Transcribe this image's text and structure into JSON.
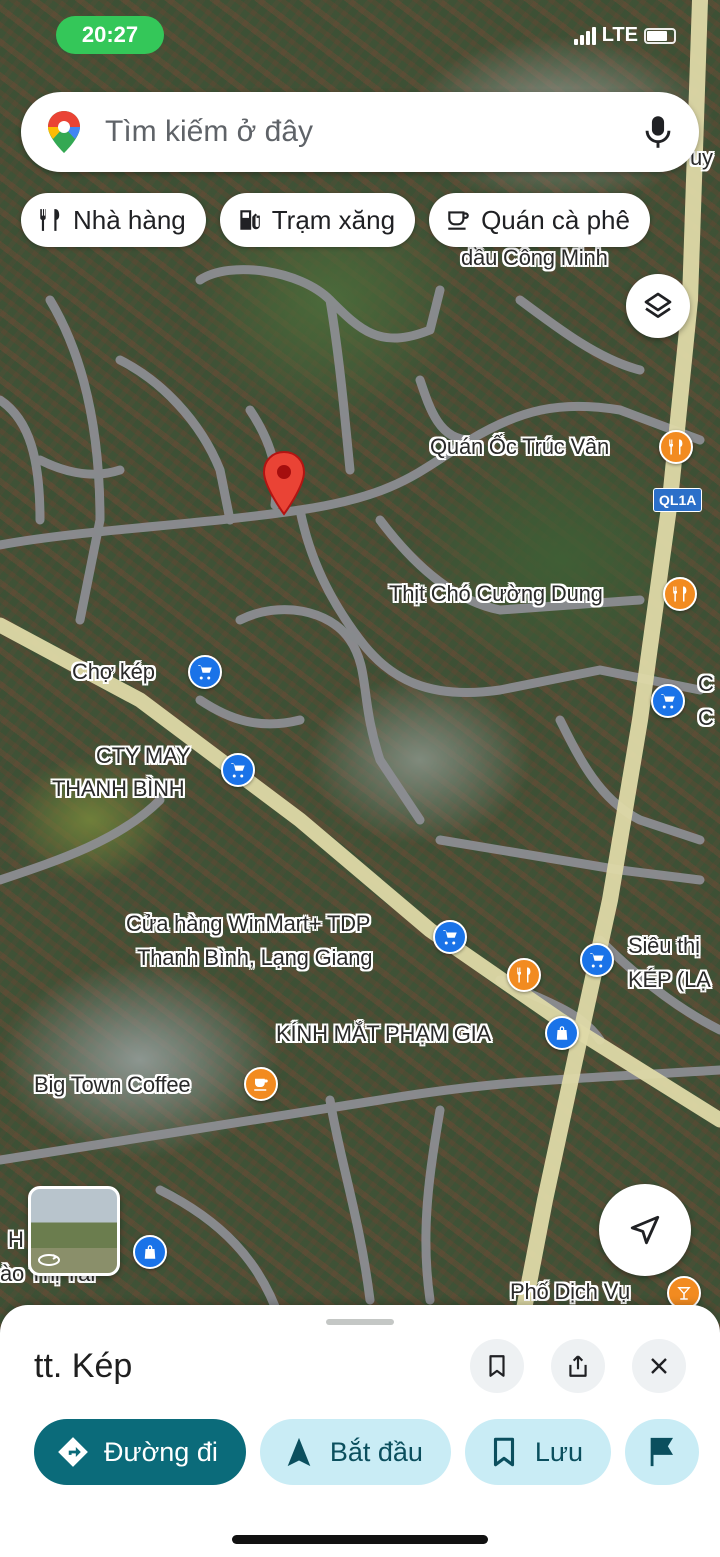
{
  "status_bar": {
    "time": "20:27",
    "network": "LTE"
  },
  "search": {
    "placeholder": "Tìm kiếm ở đây"
  },
  "chips": [
    {
      "label": "Nhà hàng",
      "icon": "restaurant-icon"
    },
    {
      "label": "Trạm xăng",
      "icon": "gas-station-icon"
    },
    {
      "label": "Quán cà phê",
      "icon": "coffee-icon"
    }
  ],
  "map": {
    "road_shield": "QL1A",
    "labels": {
      "cong_minh": "dầu Công Minh",
      "truc_van": "Quán Ốc Trúc Vân",
      "cuong_dung": "Thịt Chó Cường Dung",
      "cho_kep": "Chợ kép",
      "cty_may_1": "CTY MAY",
      "cty_may_2": "THANH BÌNH",
      "winmart_1": "Cửa hàng WinMart+ TDP",
      "winmart_2": "Thanh Bình, Lạng Giang",
      "sieu_thi_1": "Siêu thị",
      "sieu_thi_2": "KÉP (LẠ",
      "kinh_mat": "KÍNH MẮT PHẠM GIA",
      "big_town": "Big Town Coffee",
      "pho_dich_vu": "Phố Dịch Vụ",
      "edge_c1": "C",
      "edge_c2": "C",
      "edge_h": "H",
      "edge_ao": "ào Thị Tài",
      "edge_uy": "uy"
    }
  },
  "sheet": {
    "title": "tt. Kép",
    "actions": {
      "directions": "Đường đi",
      "start": "Bắt đầu",
      "save": "Lưu"
    }
  },
  "colors": {
    "accent": "#0b6b7a",
    "poi_blue": "#1a73e8",
    "poi_orange": "#f28b20",
    "marker_red": "#ea4335"
  }
}
